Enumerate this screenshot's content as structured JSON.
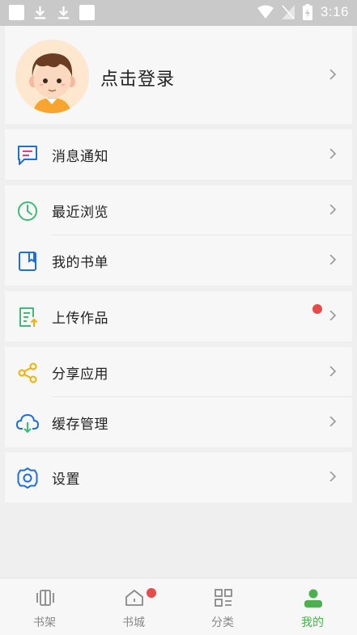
{
  "status_bar": {
    "time": "3:16"
  },
  "profile": {
    "login_text": "点击登录"
  },
  "menu_groups": [
    {
      "items": [
        {
          "label": "消息通知"
        }
      ]
    },
    {
      "items": [
        {
          "label": "最近浏览"
        },
        {
          "label": "我的书单"
        }
      ]
    },
    {
      "items": [
        {
          "label": "上传作品"
        }
      ]
    },
    {
      "items": [
        {
          "label": "分享应用"
        },
        {
          "label": "缓存管理"
        }
      ]
    },
    {
      "items": [
        {
          "label": "设置"
        }
      ]
    }
  ],
  "bottom_nav": [
    {
      "label": "书架"
    },
    {
      "label": "书城"
    },
    {
      "label": "分类"
    },
    {
      "label": "我的"
    }
  ],
  "colors": {
    "accent": "#4caf50",
    "badge": "#e84a4a",
    "icon_blue": "#1e6fd9",
    "icon_green": "#3dbb7a",
    "icon_yellow": "#f2b100"
  }
}
